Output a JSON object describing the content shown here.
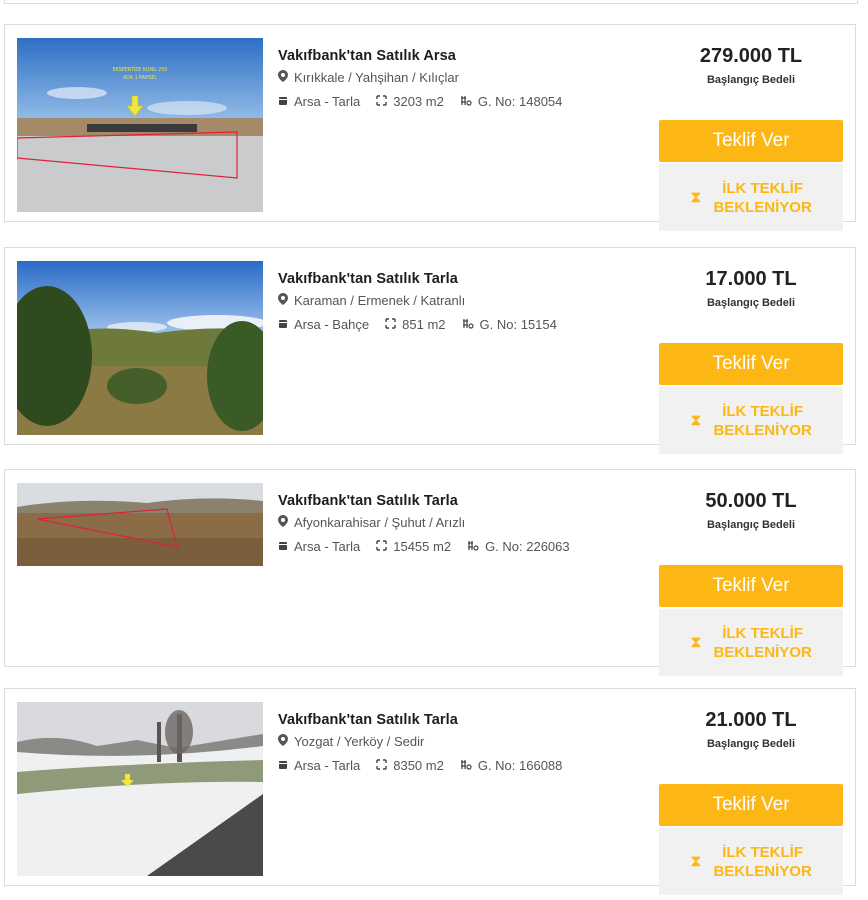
{
  "listings": [
    {
      "title": "Vakıfbank'tan Satılık Arsa",
      "location": "Kırıkkale / Yahşihan / Kılıçlar",
      "type": "Arsa - Tarla",
      "area": "3203 m2",
      "gno": "G. No: 148054",
      "price": "279.000 TL",
      "price_label": "Başlangıç Bedeli",
      "offer_label": "Teklif Ver",
      "status_line1": "İLK TEKLİF",
      "status_line2": "BEKLENİYOR",
      "image_overlay_1": "EKSPERTİZE KONU 250",
      "image_overlay_2": "ADA 1 PARSEL"
    },
    {
      "title": "Vakıfbank'tan Satılık Tarla",
      "location": "Karaman / Ermenek / Katranlı",
      "type": "Arsa - Bahçe",
      "area": "851 m2",
      "gno": "G. No: 15154",
      "price": "17.000 TL",
      "price_label": "Başlangıç Bedeli",
      "offer_label": "Teklif Ver",
      "status_line1": "İLK TEKLİF",
      "status_line2": "BEKLENİYOR"
    },
    {
      "title": "Vakıfbank'tan Satılık Tarla",
      "location": "Afyonkarahisar / Şuhut / Arızlı",
      "type": "Arsa - Tarla",
      "area": "15455 m2",
      "gno": "G. No: 226063",
      "price": "50.000 TL",
      "price_label": "Başlangıç Bedeli",
      "offer_label": "Teklif Ver",
      "status_line1": "İLK TEKLİF",
      "status_line2": "BEKLENİYOR"
    },
    {
      "title": "Vakıfbank'tan Satılık Tarla",
      "location": "Yozgat / Yerköy / Sedir",
      "type": "Arsa - Tarla",
      "area": "8350 m2",
      "gno": "G. No: 166088",
      "price": "21.000 TL",
      "price_label": "Başlangıç Bedeli",
      "offer_label": "Teklif Ver",
      "status_line1": "İLK TEKLİF",
      "status_line2": "BEKLENİYOR"
    }
  ],
  "icons": {
    "location": "map-pin-icon",
    "type": "land-type-icon",
    "area": "area-corners-icon",
    "gno": "id-number-icon",
    "status": "hourglass-icon"
  },
  "colors": {
    "accent": "#fdb714",
    "status_bg": "#f1f1f1",
    "border": "#dcdcdc"
  }
}
